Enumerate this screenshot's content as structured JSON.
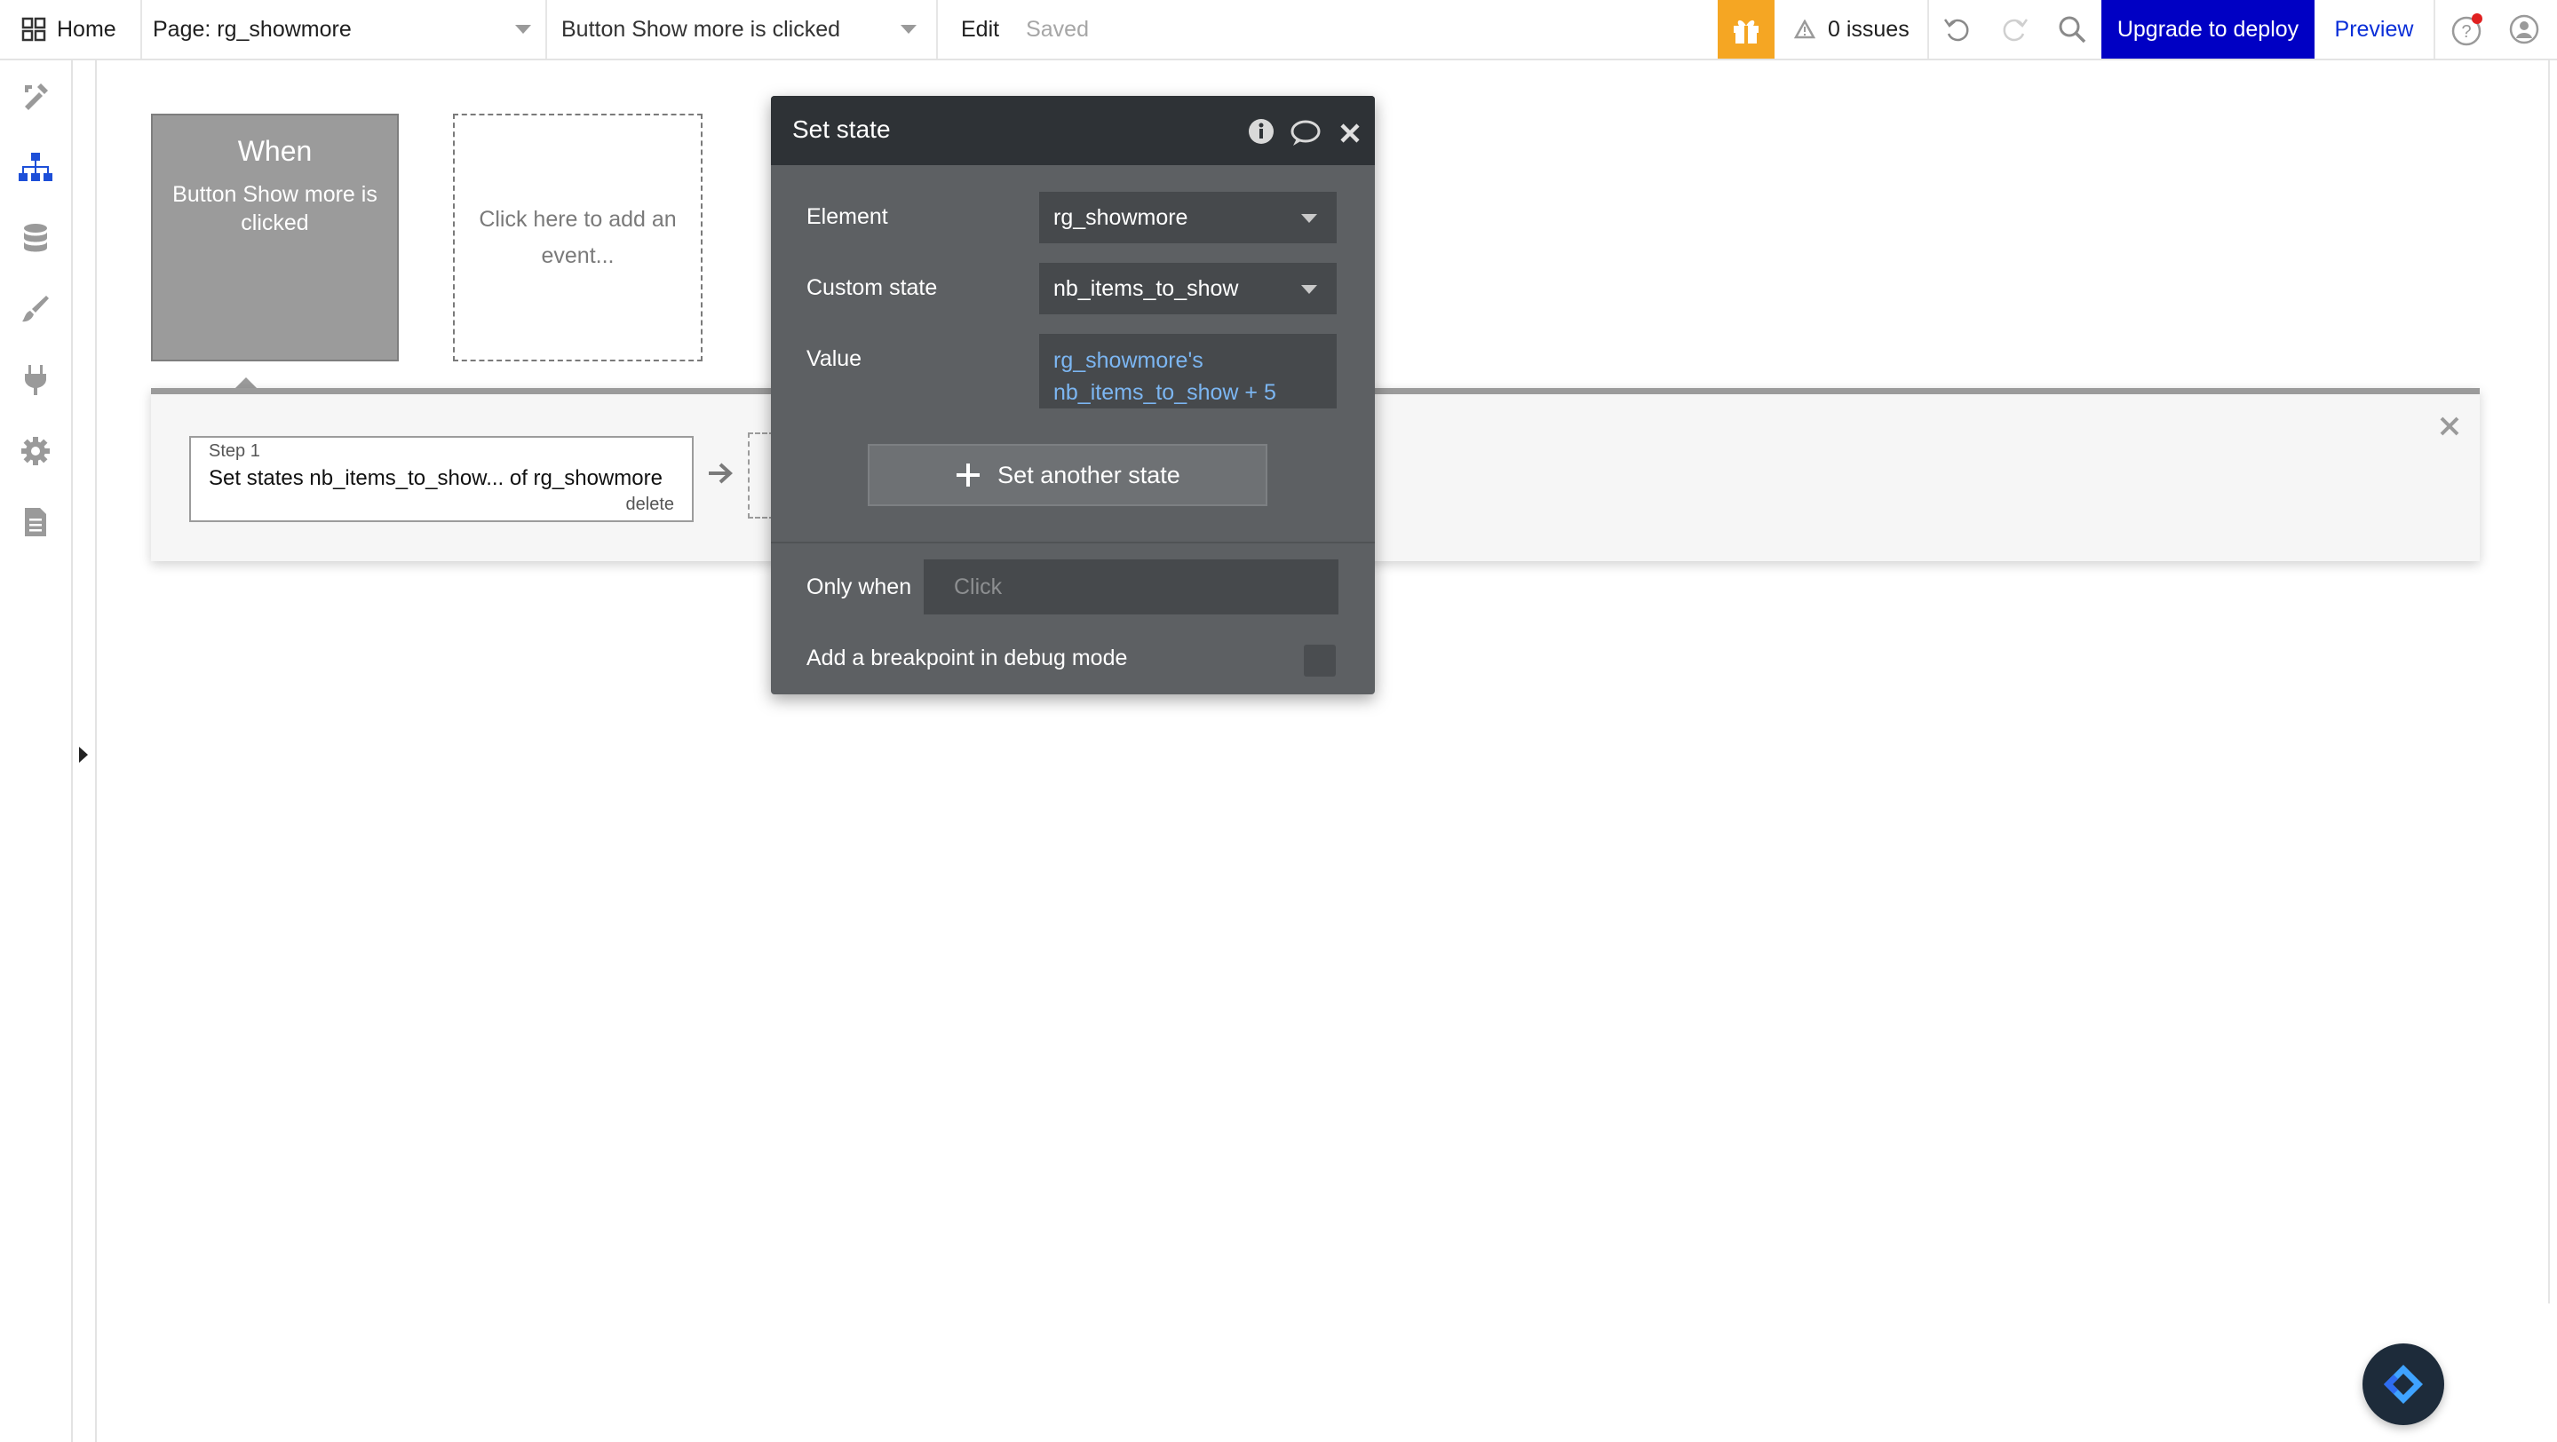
{
  "topbar": {
    "home_label": "Home",
    "page_selector": "Page: rg_showmore",
    "event_selector": "Button Show more is clicked",
    "edit_label": "Edit",
    "saved_label": "Saved",
    "issues_label": "0 issues",
    "upgrade_label": "Upgrade to deploy",
    "preview_label": "Preview"
  },
  "canvas": {
    "when_card": {
      "title": "When",
      "subtitle": "Button Show more is clicked"
    },
    "add_event_label": "Click here to add an event...",
    "step": {
      "step_label": "Step 1",
      "description": "Set states nb_items_to_show... of rg_showmore",
      "delete_label": "delete"
    }
  },
  "dialog": {
    "title": "Set state",
    "element_label": "Element",
    "element_value": "rg_showmore",
    "custom_state_label": "Custom state",
    "custom_state_value": "nb_items_to_show",
    "value_label": "Value",
    "value_line1": "rg_showmore's",
    "value_line2": "nb_items_to_show + 5",
    "set_another_label": "Set another state",
    "only_when_label": "Only when",
    "only_when_placeholder": "Click",
    "breakpoint_label": "Add a breakpoint in debug mode"
  },
  "colors": {
    "upgrade_bg": "#0000c4",
    "gift_bg": "#f5a623",
    "preview_text": "#0b2fd8",
    "dialog_header": "#2e3236",
    "dialog_body": "#5d6063",
    "expression_text": "#7cb6f2",
    "workflow_card": "#9b9b9b"
  },
  "icons": {
    "topbar": [
      "apps-grid-icon",
      "gift-icon",
      "warning-icon",
      "undo-icon",
      "redo-icon",
      "search-icon",
      "help-icon",
      "user-icon"
    ],
    "sidebar": [
      "design-tools-icon",
      "workflow-hierarchy-icon",
      "database-icon",
      "brush-icon",
      "plugin-icon",
      "settings-gear-icon",
      "logs-document-icon"
    ],
    "dialog": [
      "info-icon",
      "comment-icon",
      "close-icon",
      "plus-icon"
    ]
  }
}
